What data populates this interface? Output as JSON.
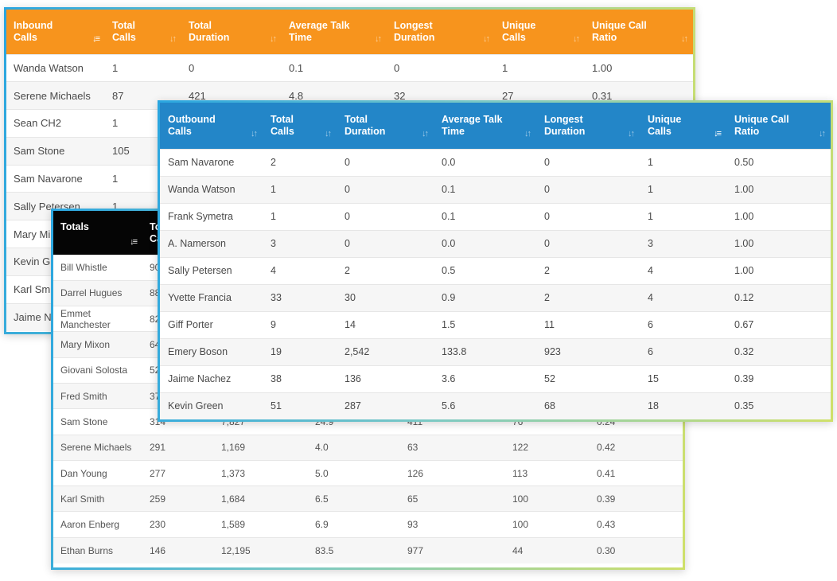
{
  "inbound": {
    "headers": [
      "Inbound Calls",
      "Total Calls",
      "Total Duration",
      "Average Talk Time",
      "Longest Duration",
      "Unique Calls",
      "Unique Call Ratio"
    ],
    "header_lines": [
      [
        "Inbound",
        "Calls"
      ],
      [
        "Total",
        "Calls"
      ],
      [
        "Total",
        "Duration"
      ],
      [
        "Average Talk",
        "Time"
      ],
      [
        "Longest",
        "Duration"
      ],
      [
        "Unique",
        "Calls"
      ],
      [
        "Unique Call",
        "Ratio"
      ]
    ],
    "color": "#f7941d",
    "rows": [
      [
        "Wanda Watson",
        "1",
        "0",
        "0.1",
        "0",
        "1",
        "1.00"
      ],
      [
        "Serene Michaels",
        "87",
        "421",
        "4.8",
        "32",
        "27",
        "0.31"
      ],
      [
        "Sean CH2",
        "1",
        "",
        "",
        "",
        "",
        ""
      ],
      [
        "Sam Stone",
        "105",
        "",
        "",
        "",
        "",
        ""
      ],
      [
        "Sam Navarone",
        "1",
        "",
        "",
        "",
        "",
        ""
      ],
      [
        "Sally Petersen",
        "1",
        "",
        "",
        "",
        "",
        ""
      ],
      [
        "Mary Mi",
        "",
        "",
        "",
        "",
        "",
        ""
      ],
      [
        "Kevin G",
        "",
        "",
        "",
        "",
        "",
        ""
      ],
      [
        "Karl Smi",
        "",
        "",
        "",
        "",
        "",
        ""
      ],
      [
        "Jaime N",
        "",
        "",
        "",
        "",
        "",
        ""
      ]
    ]
  },
  "totals": {
    "header_lines": [
      [
        "Totals"
      ],
      [
        "To",
        "Ca"
      ],
      [
        ""
      ],
      [
        ""
      ],
      [
        ""
      ],
      [
        ""
      ],
      [
        ""
      ]
    ],
    "color": "#050505",
    "rows": [
      [
        "Bill Whistle",
        "90",
        "",
        "",
        "",
        "",
        ""
      ],
      [
        "Darrel Hugues",
        "88",
        "",
        "",
        "",
        "",
        ""
      ],
      [
        "Emmet Manchester",
        "82",
        "",
        "",
        "",
        "",
        ""
      ],
      [
        "Mary Mixon",
        "64",
        "",
        "",
        "",
        "",
        ""
      ],
      [
        "Giovani Solosta",
        "52",
        "",
        "",
        "",
        "",
        ""
      ],
      [
        "Fred Smith",
        "37",
        "",
        "",
        "",
        "",
        ""
      ],
      [
        "Sam Stone",
        "314",
        "7,827",
        "24.9",
        "411",
        "76",
        "0.24"
      ],
      [
        "Serene Michaels",
        "291",
        "1,169",
        "4.0",
        "63",
        "122",
        "0.42"
      ],
      [
        "Dan Young",
        "277",
        "1,373",
        "5.0",
        "126",
        "113",
        "0.41"
      ],
      [
        "Karl Smith",
        "259",
        "1,684",
        "6.5",
        "65",
        "100",
        "0.39"
      ],
      [
        "Aaron Enberg",
        "230",
        "1,589",
        "6.9",
        "93",
        "100",
        "0.43"
      ],
      [
        "Ethan Burns",
        "146",
        "12,195",
        "83.5",
        "977",
        "44",
        "0.30"
      ]
    ]
  },
  "outbound": {
    "header_lines": [
      [
        "Outbound",
        "Calls"
      ],
      [
        "Total",
        "Calls"
      ],
      [
        "Total",
        "Duration"
      ],
      [
        "Average Talk",
        "Time"
      ],
      [
        "Longest",
        "Duration"
      ],
      [
        "Unique",
        "Calls"
      ],
      [
        "Unique Call",
        "Ratio"
      ]
    ],
    "color": "#2386c8",
    "rows": [
      [
        "Sam Navarone",
        "2",
        "0",
        "0.0",
        "0",
        "1",
        "0.50"
      ],
      [
        "Wanda Watson",
        "1",
        "0",
        "0.1",
        "0",
        "1",
        "1.00"
      ],
      [
        "Frank Symetra",
        "1",
        "0",
        "0.1",
        "0",
        "1",
        "1.00"
      ],
      [
        "A. Namerson",
        "3",
        "0",
        "0.0",
        "0",
        "3",
        "1.00"
      ],
      [
        "Sally Petersen",
        "4",
        "2",
        "0.5",
        "2",
        "4",
        "1.00"
      ],
      [
        "Yvette Francia",
        "33",
        "30",
        "0.9",
        "2",
        "4",
        "0.12"
      ],
      [
        "Giff Porter",
        "9",
        "14",
        "1.5",
        "11",
        "6",
        "0.67"
      ],
      [
        "Emery Boson",
        "19",
        "2,542",
        "133.8",
        "923",
        "6",
        "0.32"
      ],
      [
        "Jaime Nachez",
        "38",
        "136",
        "3.6",
        "52",
        "15",
        "0.39"
      ],
      [
        "Kevin Green",
        "51",
        "287",
        "5.6",
        "68",
        "18",
        "0.35"
      ]
    ]
  },
  "icons": {
    "sort": "sort-arrows-icon",
    "sort_active": "sort-desc-icon"
  }
}
